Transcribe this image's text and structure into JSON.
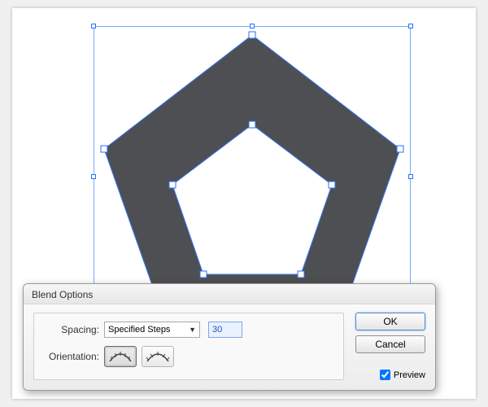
{
  "dialog": {
    "title": "Blend Options",
    "spacing_label": "Spacing:",
    "spacing_mode": "Specified Steps",
    "steps_value": "30",
    "orientation_label": "Orientation:",
    "ok_label": "OK",
    "cancel_label": "Cancel",
    "preview_label": "Preview",
    "preview_checked": true
  },
  "icons": {
    "dropdown": "▼"
  }
}
